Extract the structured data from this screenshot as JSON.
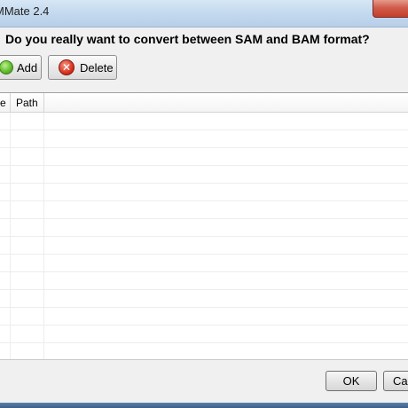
{
  "window": {
    "title": "MMate 2.4"
  },
  "dialog": {
    "question": "Do you really want to convert between SAM and BAM format?"
  },
  "toolbar": {
    "add_label": "Add",
    "delete_label": "Delete"
  },
  "table": {
    "columns": [
      "e",
      "Path"
    ],
    "rows": [
      [
        "",
        ""
      ],
      [
        "",
        ""
      ],
      [
        "",
        ""
      ],
      [
        "",
        ""
      ],
      [
        "",
        ""
      ],
      [
        "",
        ""
      ],
      [
        "",
        ""
      ],
      [
        "",
        ""
      ],
      [
        "",
        ""
      ],
      [
        "",
        ""
      ],
      [
        "",
        ""
      ],
      [
        "",
        ""
      ],
      [
        "",
        ""
      ],
      [
        "",
        ""
      ]
    ]
  },
  "footer": {
    "ok_label": "OK",
    "cancel_label": "Cancel"
  },
  "icons": {
    "add": "green-plus-circle-icon",
    "delete": "red-x-circle-icon"
  },
  "colors": {
    "titlebar": "#c2d8ee",
    "close_button": "#c23f2b",
    "background": "#f0f0f0"
  }
}
